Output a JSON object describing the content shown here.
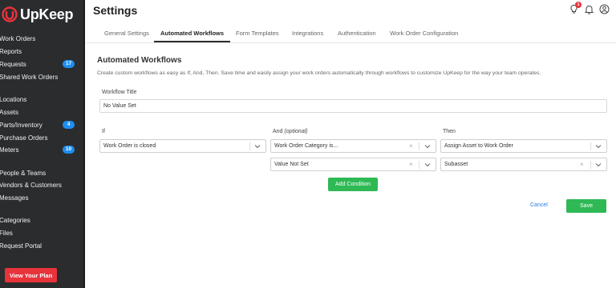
{
  "app": {
    "name": "UpKeep",
    "brand_color": "#e8333b"
  },
  "sidebar": {
    "items": [
      {
        "label": "Work Orders"
      },
      {
        "label": "Reports"
      },
      {
        "label": "Requests",
        "badge": "17"
      },
      {
        "label": "Shared Work Orders"
      },
      {
        "label": "Locations"
      },
      {
        "label": "Assets"
      },
      {
        "label": "Parts/Inventory",
        "badge": "4"
      },
      {
        "label": "Purchase Orders"
      },
      {
        "label": "Meters",
        "badge": "10"
      },
      {
        "label": "People & Teams"
      },
      {
        "label": "Vendors & Customers"
      },
      {
        "label": "Messages"
      },
      {
        "label": "Categories"
      },
      {
        "label": "Files"
      },
      {
        "label": "Request Portal"
      }
    ],
    "plan_button": "View Your Plan"
  },
  "header": {
    "title": "Settings",
    "notification_count": "1",
    "icons": [
      "lightbulb-icon",
      "bell-icon",
      "user-icon"
    ]
  },
  "tabs": [
    {
      "label": "General Settings"
    },
    {
      "label": "Automated Workflows",
      "active": true
    },
    {
      "label": "Form Templates"
    },
    {
      "label": "Integrations"
    },
    {
      "label": "Authentication"
    },
    {
      "label": "Work Order Configuration"
    }
  ],
  "main": {
    "section_title": "Automated Workflows",
    "description": "Create custom workflows as easy as If, And, Then. Save time and easily assign your work orders automatically through workflows to customize UpKeep for the way your team operates.",
    "workflow_title_label": "Workflow Title",
    "workflow_title_value": "No Value Set",
    "if_label": "If",
    "and_label": "And",
    "and_optional": "(optional)",
    "then_label": "Then",
    "if_select": "Work Order is closed",
    "and_select_1": "Work Order Category is...",
    "and_select_2": "Value Not Set",
    "then_select_1": "Assign Asset to Work Order",
    "then_select_2": "Subasset",
    "add_condition": "Add Condition",
    "cancel": "Cancel",
    "save": "Save"
  },
  "colors": {
    "accent_green": "#2eb955",
    "link_blue": "#2a7ae2",
    "badge_blue": "#1f8ef1",
    "sidebar_bg": "#2b2c2e"
  }
}
